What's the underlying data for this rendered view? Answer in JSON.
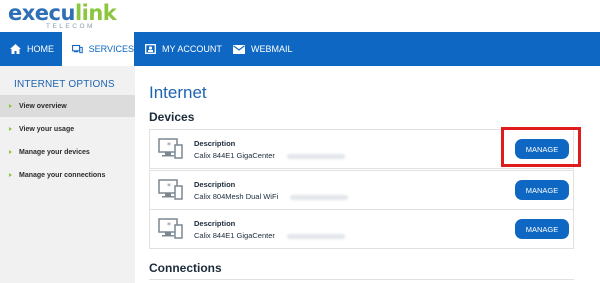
{
  "logo": {
    "brand_part1": "execu",
    "brand_part2": "link",
    "tagline": "TELECOM"
  },
  "nav": {
    "items": [
      {
        "label": "HOME",
        "icon": "home-icon"
      },
      {
        "label": "SERVICES",
        "icon": "services-icon",
        "active": true
      },
      {
        "label": "MY ACCOUNT",
        "icon": "account-icon"
      },
      {
        "label": "WEBMAIL",
        "icon": "mail-icon"
      }
    ]
  },
  "sidebar": {
    "title": "INTERNET OPTIONS",
    "items": [
      {
        "label": "View overview",
        "active": true
      },
      {
        "label": "View your usage"
      },
      {
        "label": "Manage your devices"
      },
      {
        "label": "Manage your connections"
      }
    ]
  },
  "main": {
    "title": "Internet",
    "devices_heading": "Devices",
    "connections_heading": "Connections",
    "devices": [
      {
        "label": "Description",
        "value": "Calix 844E1 GigaCenter",
        "button": "MANAGE",
        "highlighted": true
      },
      {
        "label": "Description",
        "value": "Calix 804Mesh Dual WiFi",
        "button": "MANAGE"
      },
      {
        "label": "Description",
        "value": "Calix 844E1 GigaCenter",
        "button": "MANAGE"
      }
    ]
  },
  "colors": {
    "primary": "#0e67c2",
    "accent_green": "#8cc63f",
    "highlight": "#e01b1b"
  }
}
